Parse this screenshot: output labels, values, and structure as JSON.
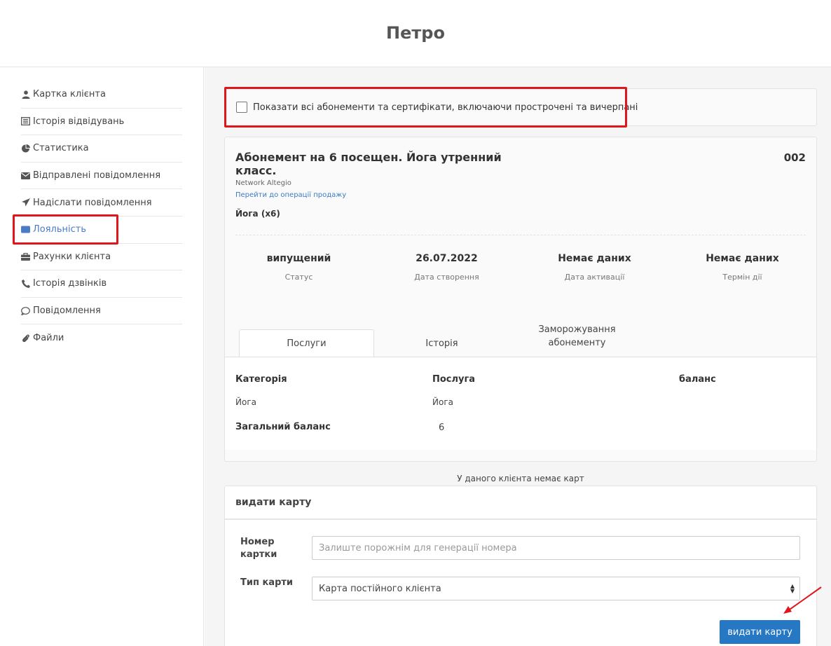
{
  "header": {
    "title": "Петро"
  },
  "sidebar": {
    "items": [
      {
        "label": "Картка клієнта",
        "icon": "user-icon"
      },
      {
        "label": "Історія відвідувань",
        "icon": "list-icon"
      },
      {
        "label": "Статистика",
        "icon": "pie-chart-icon"
      },
      {
        "label": "Відправлені повідомлення",
        "icon": "envelope-icon"
      },
      {
        "label": "Надіслати повідомлення",
        "icon": "paper-plane-icon"
      },
      {
        "label": "Лояльність",
        "icon": "credit-card-icon",
        "active": true
      },
      {
        "label": "Рахунки клієнта",
        "icon": "briefcase-icon"
      },
      {
        "label": "Історія дзвінків",
        "icon": "phone-icon"
      },
      {
        "label": "Повідомлення",
        "icon": "chat-bubble-icon"
      },
      {
        "label": "Файли",
        "icon": "paperclip-icon"
      }
    ]
  },
  "filter": {
    "show_all_label": "Показати всі абонементи та сертифікати, включаючи прострочені та вичерпані",
    "checked": false
  },
  "subscription": {
    "title": "Абонемент на 6 посещен. Йога утренний класс.",
    "number": "002",
    "network": "Network Altegio",
    "sale_link": "Перейти до операції продажу",
    "service_summary": "Йога (x6)",
    "stats": [
      {
        "value": "випущений",
        "label": "Статус"
      },
      {
        "value": "26.07.2022",
        "label": "Дата створення"
      },
      {
        "value": "Немає даних",
        "label": "Дата активації"
      },
      {
        "value": "Немає даних",
        "label": "Термін дії"
      }
    ],
    "tabs": [
      {
        "label": "Послуги",
        "active": true
      },
      {
        "label": "Історія",
        "active": false
      },
      {
        "label": "Заморожування абонементу",
        "active": false
      }
    ],
    "table": {
      "headers": [
        "Категорія",
        "Послуга",
        "баланс"
      ],
      "rows": [
        {
          "category": "Йога",
          "service": "Йога",
          "balance": ""
        }
      ],
      "total_label": "Загальний баланс",
      "total_value": "6"
    }
  },
  "cards": {
    "empty_text": "У даного клієнта немає карт",
    "issue_title": "видати карту",
    "number_label": "Номер картки",
    "number_placeholder": "Залиште порожнім для генерації номера",
    "type_label": "Тип карти",
    "type_selected": "Карта постійного клієнта",
    "issue_button": "видати карту"
  },
  "colors": {
    "accent": "#2778c4",
    "active_link": "#4a7cc6",
    "highlight": "#e0161b"
  }
}
